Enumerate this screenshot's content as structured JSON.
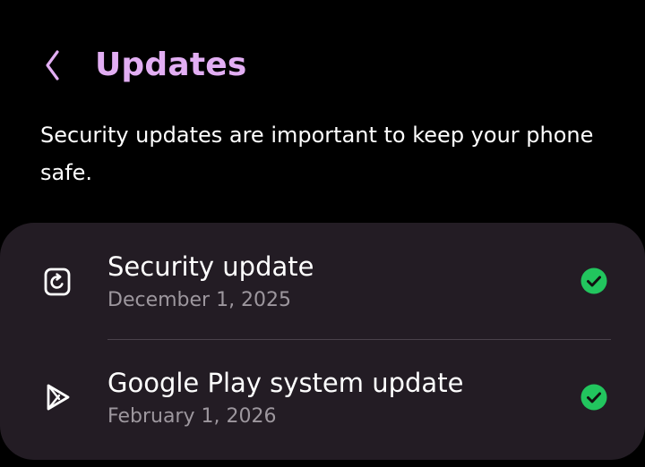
{
  "header": {
    "title": "Updates",
    "back_icon": "chevron-left-icon"
  },
  "description": "Security updates are important to keep your phone safe.",
  "updates": [
    {
      "title": "Security update",
      "date": "December 1, 2025",
      "icon": "security-update-icon",
      "status_icon": "check-circle-icon"
    },
    {
      "title": "Google Play system update",
      "date": "February 1, 2026",
      "icon": "google-play-icon",
      "status_icon": "check-circle-icon"
    }
  ],
  "colors": {
    "background": "#000000",
    "card": "#231c24",
    "title_accent": "#e2aef3",
    "subtitle": "#9d979e",
    "success": "#22c55e"
  }
}
